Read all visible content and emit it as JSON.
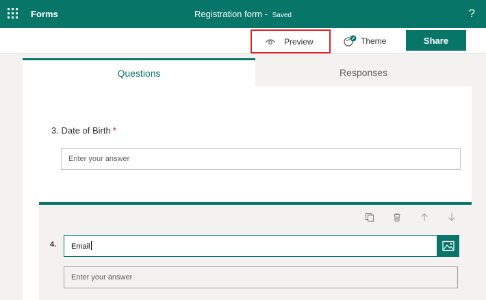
{
  "app": {
    "name": "Forms",
    "accent": "#077568"
  },
  "header": {
    "title": "Registration form",
    "separator": "-",
    "status": "Saved",
    "help": "?"
  },
  "toolbar": {
    "preview_label": "Preview",
    "theme_label": "Theme",
    "share_label": "Share"
  },
  "tabs": [
    {
      "label": "Questions",
      "active": true
    },
    {
      "label": "Responses",
      "active": false
    }
  ],
  "questions": [
    {
      "label": "3. Date of Birth",
      "required_mark": "*",
      "placeholder": "Enter your answer"
    },
    {
      "number": "4.",
      "title_value": "Email",
      "placeholder": "Enter your answer"
    }
  ],
  "icons": [
    "waffle-icon",
    "eye-icon",
    "theme-icon",
    "copy-icon",
    "delete-icon",
    "move-up-icon",
    "move-down-icon",
    "image-icon"
  ]
}
